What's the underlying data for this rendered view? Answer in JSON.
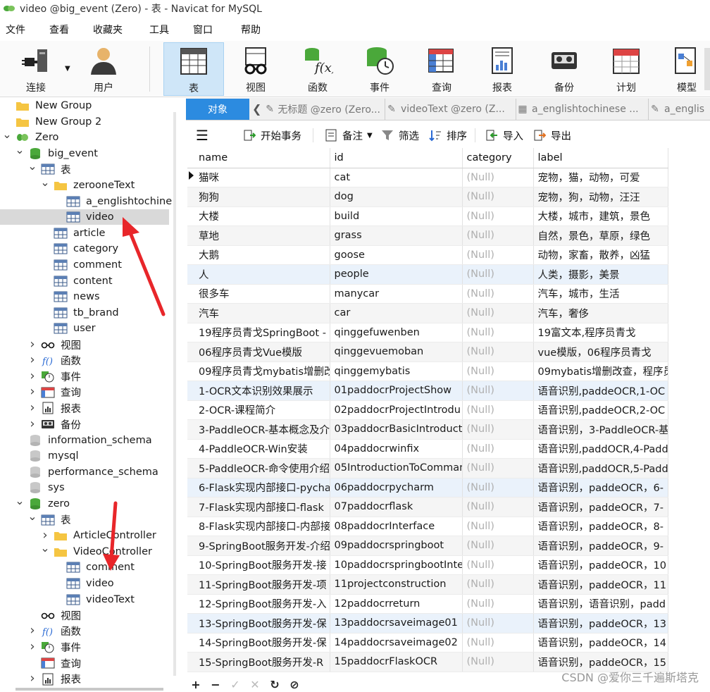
{
  "window": {
    "title": "video @big_event (Zero) - 表 - Navicat for MySQL"
  },
  "menu": [
    "文件",
    "查看",
    "收藏夹",
    "工具",
    "窗口",
    "帮助"
  ],
  "toolbar": {
    "connect": "连接",
    "user": "用户",
    "table": "表",
    "view": "视图",
    "function": "函数",
    "event": "事件",
    "query": "查询",
    "report": "报表",
    "backup": "备份",
    "schedule": "计划",
    "model": "模型"
  },
  "tree": [
    {
      "label": "New Group",
      "level": 0,
      "icon": "folder-icon"
    },
    {
      "label": "New Group 2",
      "level": 0,
      "icon": "folder-icon"
    },
    {
      "label": "Zero",
      "level": 0,
      "icon": "connection-icon",
      "caret": "v"
    },
    {
      "label": "big_event",
      "level": 1,
      "icon": "database-icon",
      "caret": "v"
    },
    {
      "label": "表",
      "level": 2,
      "icon": "table-icon",
      "caret": "v"
    },
    {
      "label": "zerooneText",
      "level": 3,
      "icon": "folder-icon",
      "caret": "v"
    },
    {
      "label": "a_englishtochine",
      "level": 4,
      "icon": "table-icon"
    },
    {
      "label": "video",
      "level": 4,
      "icon": "table-icon",
      "selected": true
    },
    {
      "label": "article",
      "level": 3,
      "icon": "table-icon"
    },
    {
      "label": "category",
      "level": 3,
      "icon": "table-icon"
    },
    {
      "label": "comment",
      "level": 3,
      "icon": "table-icon"
    },
    {
      "label": "content",
      "level": 3,
      "icon": "table-icon"
    },
    {
      "label": "news",
      "level": 3,
      "icon": "table-icon"
    },
    {
      "label": "tb_brand",
      "level": 3,
      "icon": "table-icon"
    },
    {
      "label": "user",
      "level": 3,
      "icon": "table-icon"
    },
    {
      "label": "视图",
      "level": 2,
      "icon": "view-icon",
      "caret": ">"
    },
    {
      "label": "函数",
      "level": 2,
      "icon": "function-icon",
      "caret": ">"
    },
    {
      "label": "事件",
      "level": 2,
      "icon": "event-icon",
      "caret": ">"
    },
    {
      "label": "查询",
      "level": 2,
      "icon": "query-icon",
      "caret": ">"
    },
    {
      "label": "报表",
      "level": 2,
      "icon": "report-icon",
      "caret": ">"
    },
    {
      "label": "备份",
      "level": 2,
      "icon": "backup-icon",
      "caret": ">"
    },
    {
      "label": "information_schema",
      "level": 1,
      "icon": "database-gray-icon"
    },
    {
      "label": "mysql",
      "level": 1,
      "icon": "database-gray-icon"
    },
    {
      "label": "performance_schema",
      "level": 1,
      "icon": "database-gray-icon"
    },
    {
      "label": "sys",
      "level": 1,
      "icon": "database-gray-icon"
    },
    {
      "label": "zero",
      "level": 1,
      "icon": "database-icon",
      "caret": "v"
    },
    {
      "label": "表",
      "level": 2,
      "icon": "table-icon",
      "caret": "v"
    },
    {
      "label": "ArticleController",
      "level": 3,
      "icon": "folder-icon",
      "caret": ">"
    },
    {
      "label": "VideoController",
      "level": 3,
      "icon": "folder-icon",
      "caret": "v"
    },
    {
      "label": "comment",
      "level": 4,
      "icon": "table-icon"
    },
    {
      "label": "video",
      "level": 4,
      "icon": "table-icon"
    },
    {
      "label": "videoText",
      "level": 4,
      "icon": "table-icon"
    },
    {
      "label": "视图",
      "level": 2,
      "icon": "view-icon"
    },
    {
      "label": "函数",
      "level": 2,
      "icon": "function-icon",
      "caret": ">"
    },
    {
      "label": "事件",
      "level": 2,
      "icon": "event-icon",
      "caret": ">"
    },
    {
      "label": "查询",
      "level": 2,
      "icon": "query-icon"
    },
    {
      "label": "报表",
      "level": 2,
      "icon": "report-icon",
      "caret": ">"
    }
  ],
  "tabs": {
    "objects": "对象",
    "items": [
      "无标题 @zero (Zero...",
      "videoText @zero (Z...",
      "a_englishtochinese ...",
      "a_englis"
    ]
  },
  "gridtools": {
    "begin_tx": "开始事务",
    "note": "备注",
    "filter": "筛选",
    "sort": "排序",
    "import": "导入",
    "export": "导出"
  },
  "columns": [
    "name",
    "id",
    "category",
    "label"
  ],
  "rows": [
    [
      "猫咪",
      "cat",
      "(Null)",
      "宠物，猫，动物，可爱"
    ],
    [
      "狗狗",
      "dog",
      "(Null)",
      "宠物，狗，动物，汪汪"
    ],
    [
      "大楼",
      "build",
      "(Null)",
      "大楼，城市，建筑，景色"
    ],
    [
      "草地",
      "grass",
      "(Null)",
      "自然，景色，草原，绿色"
    ],
    [
      "大鹅",
      "goose",
      "(Null)",
      "动物，家畜，散养，凶猛"
    ],
    [
      "人",
      "people",
      "(Null)",
      "人类，摄影，美景"
    ],
    [
      "很多车",
      "manycar",
      "(Null)",
      "汽车，城市，生活"
    ],
    [
      "汽车",
      "car",
      "(Null)",
      "汽车，奢侈"
    ],
    [
      "19程序员青戈SpringBoot -",
      "qinggefuwenben",
      "(Null)",
      "19富文本,程序员青戈"
    ],
    [
      "06程序员青戈Vue模版",
      "qinggevuemoban",
      "(Null)",
      "vue模版，06程序员青戈"
    ],
    [
      "09程序员青戈mybatis增删改",
      "qinggemybatis",
      "(Null)",
      "09mybatis增删改查，程序员"
    ],
    [
      "1-OCR文本识别效果展示",
      "01paddocrProjectShow",
      "(Null)",
      "语音识别,paddeOCR,1-OC"
    ],
    [
      "2-OCR-课程简介",
      "02paddocrProjectIntrodu",
      "(Null)",
      "语音识别,paddeOCR,2-OC"
    ],
    [
      "3-PaddleOCR-基本概念及介",
      "03paddocrBasicIntroduct",
      "(Null)",
      "语音识别，3-PaddleOCR-基"
    ],
    [
      "4-PaddleOCR-Win安装",
      "04paddocrwinfix",
      "(Null)",
      "语音识别,paddOCR,4-Padd"
    ],
    [
      "5-PaddleOCR-命令使用介绍",
      "05IntroductionToComman",
      "(Null)",
      "语音识别,paddOCR,5-Padd"
    ],
    [
      "6-Flask实现内部接口-pycha",
      "06paddocrpycharm",
      "(Null)",
      "语音识别，paddeOCR，6-"
    ],
    [
      "7-Flask实现内部接口-flask",
      "07paddocrflask",
      "(Null)",
      "语音识别，paddeOCR，7-"
    ],
    [
      "8-Flask实现内部接口-内部接",
      "08paddocrInterface",
      "(Null)",
      "语音识别，paddeOCR，8-"
    ],
    [
      "9-SpringBoot服务开发-介绍",
      "09paddocrspringboot",
      "(Null)",
      "语音识别，paddeOCR，9-"
    ],
    [
      "10-SpringBoot服务开发-接",
      "10paddocrspringbootInte",
      "(Null)",
      "语音识别，paddeOCR，10"
    ],
    [
      "11-SpringBoot服务开发-项",
      "11projectconstruction",
      "(Null)",
      "语音识别，paddeOCR，11"
    ],
    [
      "12-SpringBoot服务开发-入",
      "12paddocrreturn",
      "(Null)",
      "语音识别，语音识别，padd"
    ],
    [
      "13-SpringBoot服务开发-保",
      "13paddocrsaveimage01",
      "(Null)",
      "语音识别，paddeOCR，13"
    ],
    [
      "14-SpringBoot服务开发-保",
      "14paddocrsaveimage02",
      "(Null)",
      "语音识别，paddeOCR，14"
    ],
    [
      "15-SpringBoot服务开发-R",
      "15paddocrFlaskOCR",
      "(Null)",
      "语音识别，paddeOCR，15"
    ]
  ],
  "bottombar": [
    "+",
    "−",
    "✓",
    "✕",
    "↻",
    "⊘"
  ],
  "watermark": "CSDN @爱你三千遍斯塔克",
  "colors": {
    "accent": "#2c8be0",
    "arrow": "#e8262a",
    "null_text": "#b0b0b0"
  }
}
